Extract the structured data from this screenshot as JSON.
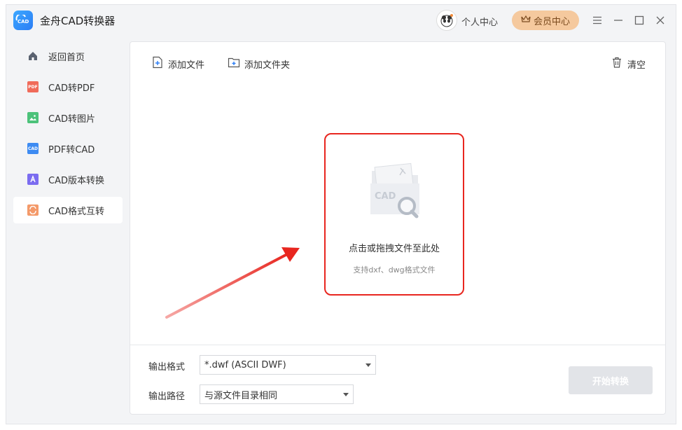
{
  "app": {
    "title": "金舟CAD转换器",
    "logo_text": "CAD"
  },
  "header": {
    "user_center_label": "个人中心",
    "vip_label": "会员中心"
  },
  "window_controls": [
    "menu-icon",
    "minimize-icon",
    "maximize-icon",
    "close-icon"
  ],
  "sidebar": {
    "items": [
      {
        "label": "返回首页",
        "icon": "home-icon",
        "active": false
      },
      {
        "label": "CAD转PDF",
        "icon": "pdf-icon",
        "icon_text": "PDF",
        "color": "#f06b5a",
        "active": false
      },
      {
        "label": "CAD转图片",
        "icon": "image-icon",
        "color": "#4cc27a",
        "active": false
      },
      {
        "label": "PDF转CAD",
        "icon": "cad-file-icon",
        "icon_text": "CAD",
        "color": "#3d8bf2",
        "active": false
      },
      {
        "label": "CAD版本转换",
        "icon": "version-icon",
        "color": "#7b6cf0",
        "active": false
      },
      {
        "label": "CAD格式互转",
        "icon": "format-convert-icon",
        "color": "#f49a6a",
        "active": true
      }
    ]
  },
  "toolbar": {
    "add_file_label": "添加文件",
    "add_folder_label": "添加文件夹",
    "clear_label": "清空"
  },
  "drop_zone": {
    "title": "点击或拖拽文件至此处",
    "subtitle": "支持dxf、dwg格式文件",
    "illustration_text": "CAD"
  },
  "output": {
    "format_label": "输出格式",
    "format_value": "*.dwf (ASCII DWF)",
    "path_label": "输出路径",
    "path_value": "与源文件目录相同"
  },
  "start_button_label": "开始转换",
  "colors": {
    "accent": "#2a7df5",
    "annotation_red": "#e8261f",
    "vip_bg": "#f5c99e"
  }
}
